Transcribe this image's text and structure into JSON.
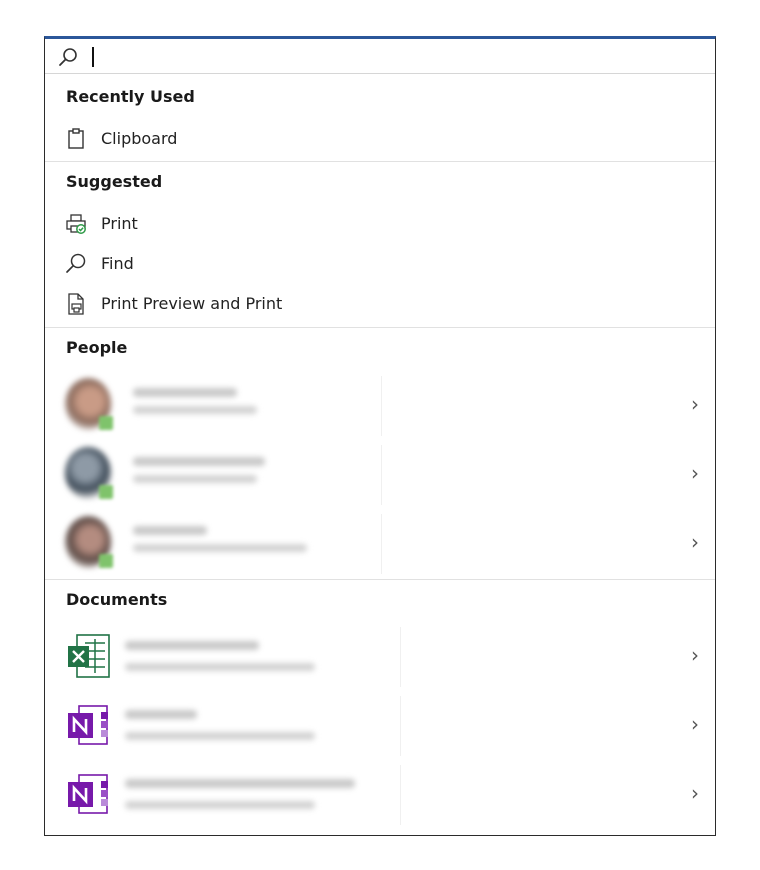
{
  "search": {
    "value": "",
    "placeholder": ""
  },
  "sections": {
    "recently_used": {
      "title": "Recently Used"
    },
    "suggested": {
      "title": "Suggested"
    },
    "people": {
      "title": "People"
    },
    "documents": {
      "title": "Documents"
    }
  },
  "recently_used_items": [
    {
      "label": "Clipboard",
      "icon": "clipboard-icon"
    }
  ],
  "suggested_items": [
    {
      "label": "Print",
      "icon": "printer-icon"
    },
    {
      "label": "Find",
      "icon": "search-icon"
    },
    {
      "label": "Print Preview and Print",
      "icon": "print-preview-icon"
    }
  ],
  "people_items": [
    {
      "icon": "avatar",
      "chevron": "›"
    },
    {
      "icon": "avatar",
      "chevron": "›"
    },
    {
      "icon": "avatar",
      "chevron": "›"
    }
  ],
  "document_items": [
    {
      "icon": "excel-icon",
      "chevron": "›"
    },
    {
      "icon": "onenote-icon",
      "chevron": "›"
    },
    {
      "icon": "onenote-icon",
      "chevron": "›"
    }
  ],
  "colors": {
    "accent_border": "#2b579a",
    "excel_green": "#217346",
    "onenote_purple": "#7719aa",
    "presence_green": "#7fc36b"
  }
}
